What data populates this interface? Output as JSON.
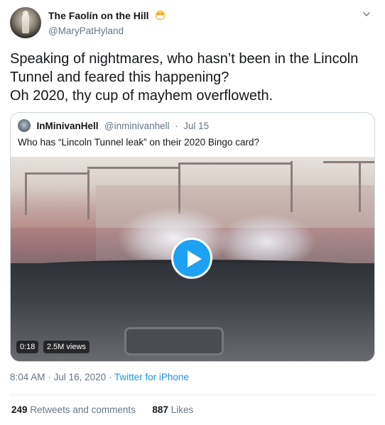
{
  "author": {
    "display_name": "The Faolín on the Hill",
    "handle": "@MaryPatHyland"
  },
  "tweet": {
    "lines": [
      "Speaking of nightmares, who hasn’t been in the Lincoln",
      "Tunnel and feared this happening?",
      "Oh 2020, thy cup of mayhem overfloweth."
    ]
  },
  "quoted": {
    "display_name": "InMinivanHell",
    "handle": "@inminivanhell",
    "separator": "·",
    "date": "Jul 15",
    "text": "Who has “Lincoln Tunnel leak” on their 2020 Bingo card?",
    "video": {
      "duration": "0:18",
      "views": "2.5M views"
    }
  },
  "meta": {
    "time": "8:04 AM",
    "sep1": "·",
    "date": "Jul 16, 2020",
    "sep2": "·",
    "source": "Twitter for iPhone"
  },
  "stats": {
    "retweets_count": "249",
    "retweets_label": "Retweets and comments",
    "likes_count": "887",
    "likes_label": "Likes"
  },
  "colors": {
    "accent": "#1da1f2",
    "link": "#1b95e0",
    "secondary_text": "#657786",
    "border": "#ccd6dd"
  },
  "icons": {
    "author_badge": "face-with-medical-mask-icon",
    "menu": "chevron-down-icon",
    "video": "play-icon"
  }
}
